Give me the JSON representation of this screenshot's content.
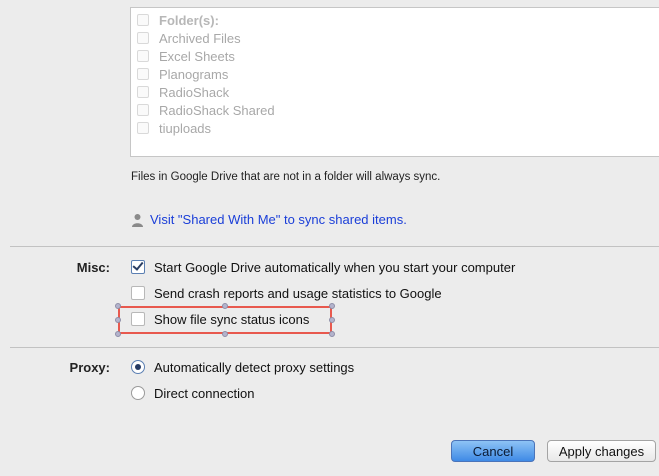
{
  "folders": {
    "header": "Folder(s):",
    "items": [
      "Archived Files",
      "Excel Sheets",
      "Planograms",
      "RadioShack",
      "RadioShack Shared",
      "tiuploads"
    ]
  },
  "note": "Files in Google Drive that are not in a folder will always sync.",
  "shared_link": "Visit \"Shared With Me\" to sync shared items.",
  "misc": {
    "label": "Misc:",
    "options": [
      {
        "text": "Start Google Drive automatically when you start your computer",
        "checked": true
      },
      {
        "text": "Send crash reports and usage statistics to Google",
        "checked": false
      },
      {
        "text": "Show file sync status icons",
        "checked": false
      }
    ]
  },
  "proxy": {
    "label": "Proxy:",
    "options": [
      {
        "text": "Automatically detect proxy settings",
        "selected": true
      },
      {
        "text": "Direct connection",
        "selected": false
      }
    ]
  },
  "buttons": {
    "cancel": "Cancel",
    "apply": "Apply changes"
  },
  "colors": {
    "link": "#1a3ed8",
    "highlight": "#e8594e",
    "primary_button": "#3f8ae6"
  }
}
